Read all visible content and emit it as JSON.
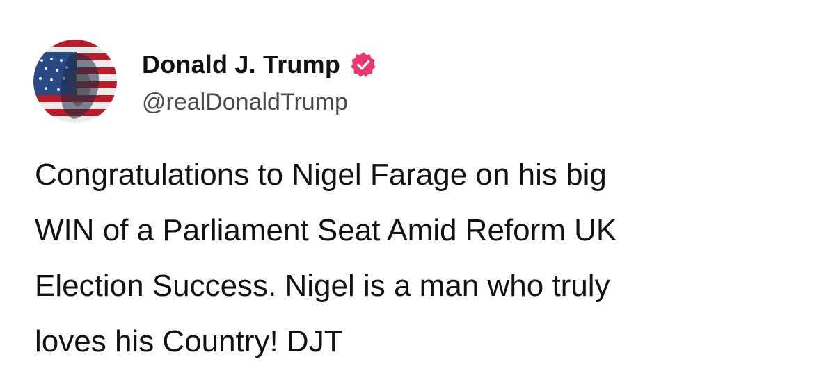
{
  "post": {
    "author": {
      "display_name": "Donald J. Trump",
      "handle": "@realDonaldTrump",
      "avatar_icon": "avatar-flag-portrait",
      "verified_icon": "verified-badge-icon",
      "verified_color": "#e8386d"
    },
    "text_lines": [
      "Congratulations to Nigel Farage on his big",
      "WIN of a Parliament Seat Amid Reform UK",
      "Election Success. Nigel is a man who truly",
      "loves his Country! DJT"
    ]
  }
}
